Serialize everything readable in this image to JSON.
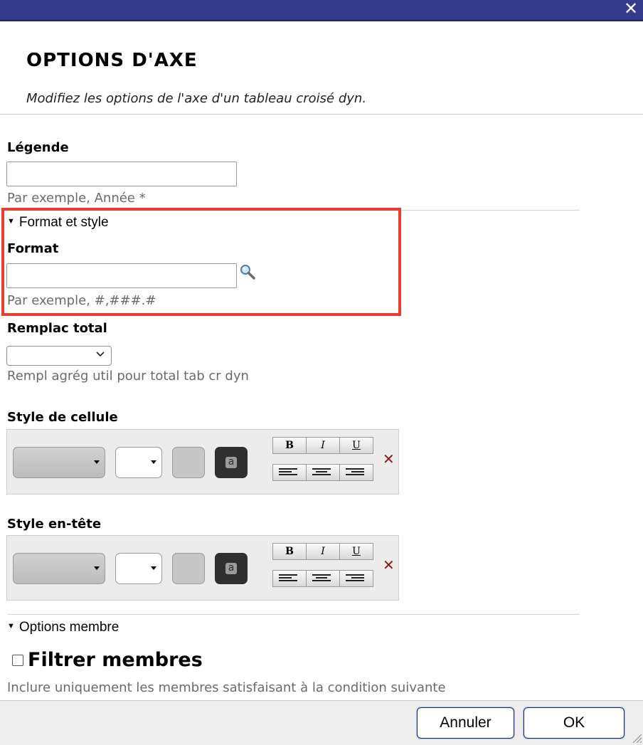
{
  "dialog": {
    "title": "OPTIONS D'AXE",
    "subtitle": "Modifiez les options de l'axe d'un tableau croisé dyn."
  },
  "legend": {
    "label": "Légende",
    "value": "",
    "help": "Par exemple, Année *"
  },
  "format_section": {
    "header": "Format et style",
    "format_label": "Format",
    "format_value": "",
    "format_help": "Par exemple, #,###.#",
    "accent_color": "#e8402e"
  },
  "total": {
    "label": "Remplac total",
    "selected": "",
    "help": "Rempl agrég util pour total tab cr dyn"
  },
  "cell_style": {
    "label": "Style de cellule",
    "bold": "B",
    "italic": "I",
    "underline": "U",
    "fg_glyph": "a"
  },
  "header_style": {
    "label": "Style en-tête",
    "bold": "B",
    "italic": "I",
    "underline": "U",
    "fg_glyph": "a"
  },
  "members": {
    "header": "Options membre",
    "filter_label": "Filtrer membres",
    "filter_checked": false,
    "filter_help": "Inclure uniquement les membres satisfaisant à la condition suivante"
  },
  "footer": {
    "cancel_label": "Annuler",
    "ok_label": "OK"
  },
  "colors": {
    "titlebar": "#343a8c",
    "remove_x": "#8a1a1a"
  }
}
